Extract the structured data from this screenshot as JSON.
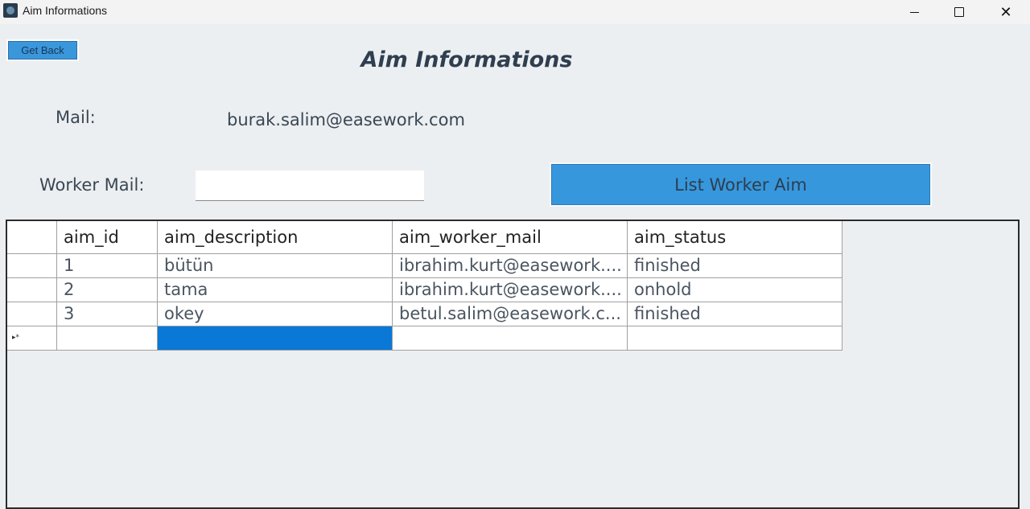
{
  "window": {
    "title": "Aim Informations"
  },
  "toolbar": {
    "get_back_label": "Get Back"
  },
  "page": {
    "title": "Aim Informations"
  },
  "mail": {
    "label": "Mail:",
    "value": "burak.salim@easework.com"
  },
  "worker_mail": {
    "label": "Worker Mail:",
    "value": "",
    "placeholder": ""
  },
  "list_button": {
    "label": "List Worker Aim"
  },
  "table": {
    "columns": [
      "aim_id",
      "aim_description",
      "aim_worker_mail",
      "aim_status"
    ],
    "rows": [
      [
        "1",
        "bütün",
        "ibrahim.kurt@easework....",
        "finished"
      ],
      [
        "2",
        "tama",
        "ibrahim.kurt@easework....",
        "onhold"
      ],
      [
        "3",
        "okey",
        "betul.salim@easework.c...",
        "finished"
      ]
    ],
    "new_row_marker": "▸*"
  },
  "colors": {
    "accent": "#3797dc",
    "selected_cell": "#0a78d7",
    "background": "#eceff1"
  }
}
